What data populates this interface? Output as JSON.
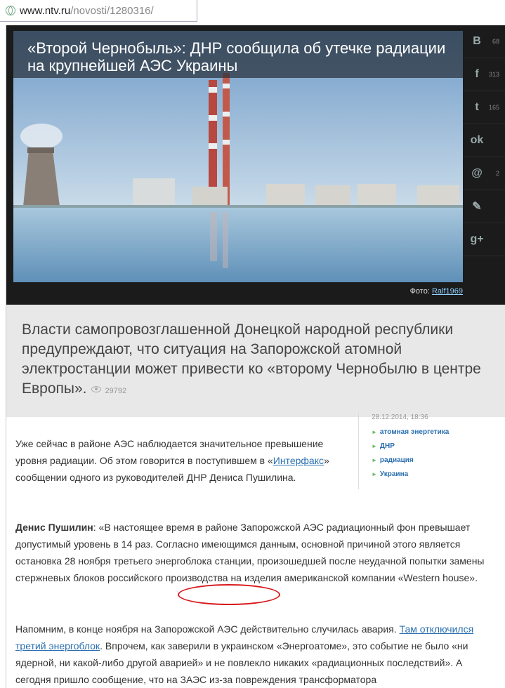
{
  "browser": {
    "url_host": "www.ntv.ru",
    "url_path": "/novosti/1280316/"
  },
  "article": {
    "headline": "«Второй Чернобыль»: ДНР сообщила об утечке радиации на крупнейшей АЭС Украины",
    "photo_credit_label": "Фото:",
    "photo_credit_author": "Ralf1969",
    "lead": "Власти самопровозглашенной Донецкой народной республики предупреждают, что ситуация на Запорожской атомной электростанции может привести ко «второму Чернобылю в центре Европы».",
    "views": "29792",
    "p1_before": "Уже сейчас в районе АЭС наблюдается значительное превышение уровня радиации. Об этом говорится в поступившем в «",
    "p1_link": "Интерфакс",
    "p1_after": "» сообщении одного из руководителей ДНР Дениса Пушилина.",
    "p2_name": "Денис Пушилин",
    "p2_text": ": «В настоящее время в районе Запорожской АЭС радиационный фон превышает допустимый уровень в 14 раз. Согласно имеющимся данным, основной причиной этого является остановка 28 ноября третьего энергоблока станции, произошедшей после неудачной попытки замены стержневых блоков российского производства на изделия американской компании «Western house».",
    "p3_before": "Напомним, в конце ноября на Запорожской АЭС действительно случилась авария. ",
    "p3_link": "Там отключился третий энергоблок",
    "p3_after": ". Впрочем, как заверили в украинском «Энергоатоме», это событие не было «ни ядерной, ни какой-либо другой аварией» и не повлекло никаких «радиационных последствий». А сегодня пришло сообщение, что на ЗАЭС из-за повреждения трансформатора"
  },
  "meta": {
    "date": "28.12.2014, 18:36",
    "tags": [
      "атомная энергетика",
      "ДНР",
      "радиация",
      "Украина"
    ]
  },
  "share": [
    {
      "icon": "vk-icon",
      "glyph": "B",
      "count": "68"
    },
    {
      "icon": "facebook-icon",
      "glyph": "f",
      "count": "313"
    },
    {
      "icon": "twitter-icon",
      "glyph": "t",
      "count": "165"
    },
    {
      "icon": "odnoklassniki-icon",
      "glyph": "ok",
      "count": ""
    },
    {
      "icon": "mail-icon",
      "glyph": "@",
      "count": "2"
    },
    {
      "icon": "livejournal-icon",
      "glyph": "✎",
      "count": ""
    },
    {
      "icon": "googleplus-icon",
      "glyph": "g+",
      "count": ""
    }
  ],
  "colors": {
    "annotation_oval": "#d8191d",
    "link": "#2a6fb0"
  }
}
